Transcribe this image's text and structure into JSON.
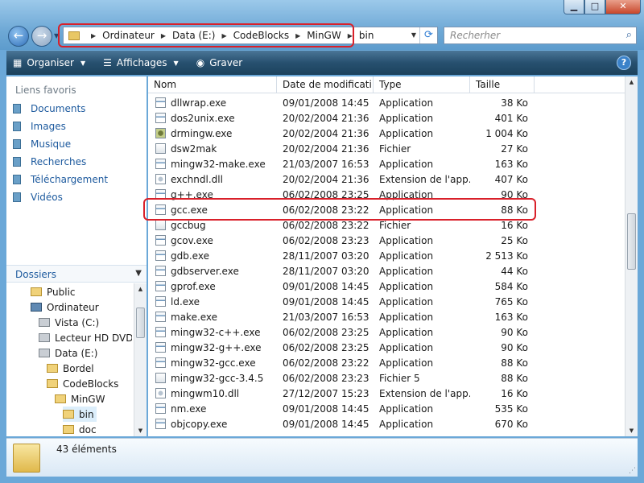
{
  "window": {
    "min": "▁",
    "max": "□",
    "close": "✕"
  },
  "nav": {
    "back": "←",
    "forward": "→",
    "history": "▼"
  },
  "address": {
    "crumbs": [
      "Ordinateur",
      "Data (E:)",
      "CodeBlocks",
      "MinGW",
      "bin"
    ],
    "dropdown": "▼",
    "refresh": "⟳"
  },
  "search": {
    "placeholder": "Recherher",
    "icon": "⌕"
  },
  "toolbar": {
    "organiser": "Organiser",
    "affichages": "Affichages",
    "graver": "Graver",
    "help": "?"
  },
  "favorites": {
    "title": "Liens favoris",
    "items": [
      "Documents",
      "Images",
      "Musique",
      "Recherches",
      "Téléchargement",
      "Vidéos"
    ]
  },
  "folders": {
    "title": "Dossiers",
    "items": [
      "Public",
      "Ordinateur",
      "Vista (C:)",
      "Lecteur HD DVD-R",
      "Data (E:)",
      "Bordel",
      "CodeBlocks",
      "MinGW",
      "bin",
      "doc"
    ]
  },
  "columns": {
    "name": "Nom",
    "date": "Date de modificati...",
    "type": "Type",
    "size": "Taille"
  },
  "files": [
    {
      "name": "dllwrap.exe",
      "date": "09/01/2008 14:45",
      "type": "Application",
      "size": "38 Ko",
      "icon": "app"
    },
    {
      "name": "dos2unix.exe",
      "date": "20/02/2004 21:36",
      "type": "Application",
      "size": "401 Ko",
      "icon": "app"
    },
    {
      "name": "drmingw.exe",
      "date": "20/02/2004 21:36",
      "type": "Application",
      "size": "1 004 Ko",
      "icon": "bug"
    },
    {
      "name": "dsw2mak",
      "date": "20/02/2004 21:36",
      "type": "Fichier",
      "size": "27 Ko",
      "icon": "file"
    },
    {
      "name": "mingw32-make.exe",
      "date": "21/03/2007 16:53",
      "type": "Application",
      "size": "163 Ko",
      "icon": "app"
    },
    {
      "name": "exchndl.dll",
      "date": "20/02/2004 21:36",
      "type": "Extension de l'app...",
      "size": "407 Ko",
      "icon": "dll"
    },
    {
      "name": "g++.exe",
      "date": "06/02/2008 23:25",
      "type": "Application",
      "size": "90 Ko",
      "icon": "app"
    },
    {
      "name": "gcc.exe",
      "date": "06/02/2008 23:22",
      "type": "Application",
      "size": "88 Ko",
      "icon": "app"
    },
    {
      "name": "gccbug",
      "date": "06/02/2008 23:22",
      "type": "Fichier",
      "size": "16 Ko",
      "icon": "file"
    },
    {
      "name": "gcov.exe",
      "date": "06/02/2008 23:23",
      "type": "Application",
      "size": "25 Ko",
      "icon": "app"
    },
    {
      "name": "gdb.exe",
      "date": "28/11/2007 03:20",
      "type": "Application",
      "size": "2 513 Ko",
      "icon": "app"
    },
    {
      "name": "gdbserver.exe",
      "date": "28/11/2007 03:20",
      "type": "Application",
      "size": "44 Ko",
      "icon": "app"
    },
    {
      "name": "gprof.exe",
      "date": "09/01/2008 14:45",
      "type": "Application",
      "size": "584 Ko",
      "icon": "app"
    },
    {
      "name": "ld.exe",
      "date": "09/01/2008 14:45",
      "type": "Application",
      "size": "765 Ko",
      "icon": "app"
    },
    {
      "name": "make.exe",
      "date": "21/03/2007 16:53",
      "type": "Application",
      "size": "163 Ko",
      "icon": "app"
    },
    {
      "name": "mingw32-c++.exe",
      "date": "06/02/2008 23:25",
      "type": "Application",
      "size": "90 Ko",
      "icon": "app"
    },
    {
      "name": "mingw32-g++.exe",
      "date": "06/02/2008 23:25",
      "type": "Application",
      "size": "90 Ko",
      "icon": "app"
    },
    {
      "name": "mingw32-gcc.exe",
      "date": "06/02/2008 23:22",
      "type": "Application",
      "size": "88 Ko",
      "icon": "app"
    },
    {
      "name": "mingw32-gcc-3.4.5",
      "date": "06/02/2008 23:23",
      "type": "Fichier 5",
      "size": "88 Ko",
      "icon": "file"
    },
    {
      "name": "mingwm10.dll",
      "date": "27/12/2007 15:23",
      "type": "Extension de l'app...",
      "size": "16 Ko",
      "icon": "dll"
    },
    {
      "name": "nm.exe",
      "date": "09/01/2008 14:45",
      "type": "Application",
      "size": "535 Ko",
      "icon": "app"
    },
    {
      "name": "objcopy.exe",
      "date": "09/01/2008 14:45",
      "type": "Application",
      "size": "670 Ko",
      "icon": "app"
    }
  ],
  "status": {
    "count": "43 éléments"
  },
  "colors": {
    "highlight": "#d9202a",
    "toolbar": "#27506f",
    "link": "#1d5a9e"
  }
}
